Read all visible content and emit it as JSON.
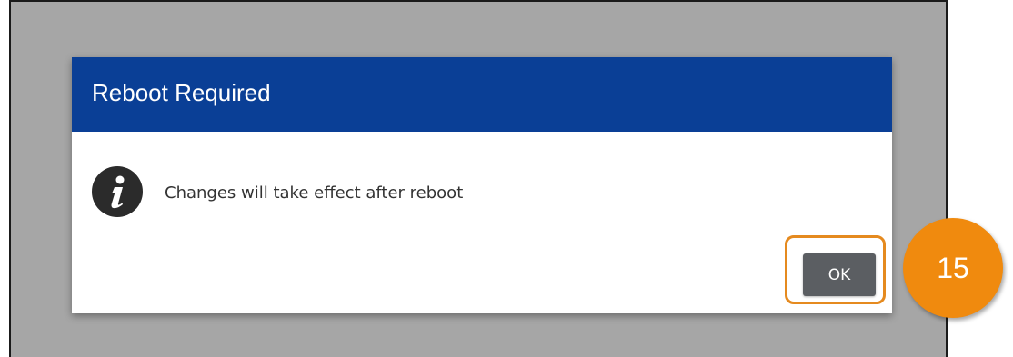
{
  "dialog": {
    "title": "Reboot Required",
    "message": "Changes will take effect after reboot",
    "icon": "info-icon",
    "ok_label": "OK"
  },
  "annotation": {
    "step_number": "15"
  },
  "colors": {
    "header_bg": "#0a3f96",
    "overlay_bg": "#a6a6a6",
    "button_bg": "#5b5e62",
    "highlight": "#e58a1f",
    "badge_bg": "#f08a0e"
  }
}
